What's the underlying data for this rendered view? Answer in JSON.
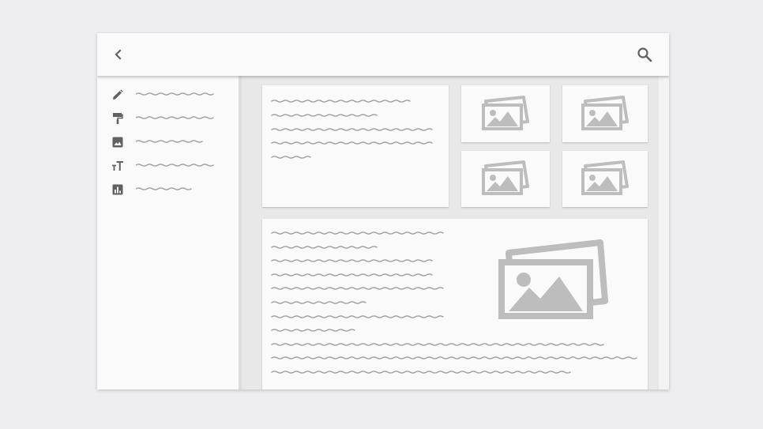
{
  "colors": {
    "background": "#eeeef0",
    "surface": "#fafafa",
    "icon": "#616161",
    "placeholder_line": "#9e9e9e",
    "image_placeholder": "#bdbdbd",
    "content_background": "#e8e8e8"
  },
  "appbar": {
    "back_icon": "chevron-left-icon",
    "search_icon": "search-icon"
  },
  "sidebar": {
    "items": [
      {
        "icon": "pencil-icon"
      },
      {
        "icon": "paint-roller-icon"
      },
      {
        "icon": "image-icon"
      },
      {
        "icon": "text-size-icon"
      },
      {
        "icon": "bar-chart-icon"
      }
    ]
  },
  "main": {
    "thumbnails": [
      {
        "icon": "image-stack-icon"
      },
      {
        "icon": "image-stack-icon"
      },
      {
        "icon": "image-stack-icon"
      },
      {
        "icon": "image-stack-icon"
      }
    ],
    "feature_image_icon": "image-stack-icon"
  }
}
